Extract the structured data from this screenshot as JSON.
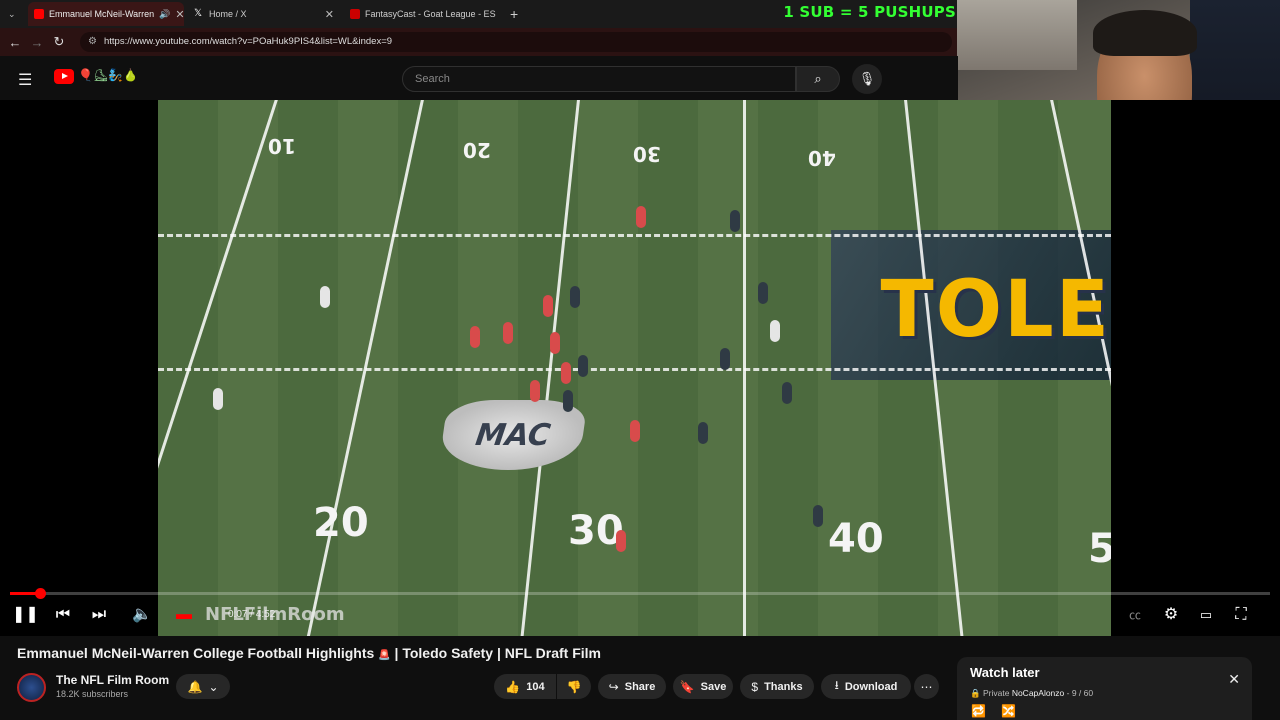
{
  "browser": {
    "tabs": [
      {
        "title": "Emmanuel McNeil-Warren",
        "favicon_color": "#ff0000",
        "active": true
      },
      {
        "title": "Home / X",
        "favicon_color": "#ffffff",
        "active": false
      },
      {
        "title": "FantasyCast - Goat League - ES",
        "favicon_color": "#cc0000",
        "active": false
      }
    ],
    "url": "https://www.youtube.com/watch?v=POaHuk9PIS4&list=WL&index=9"
  },
  "stream_overlay": {
    "text": "1 SUB = 5 PUSHUPS",
    "color": "#33ff33"
  },
  "youtube_header": {
    "search_placeholder": "Search",
    "doodle": "🎈⛸🧞🍐"
  },
  "video": {
    "field_numbers": {
      "top": [
        "10",
        "20",
        "30",
        "40"
      ],
      "bottom": [
        "20",
        "30",
        "40",
        "5"
      ]
    },
    "endzone_text": "TOLE",
    "logo_text": "MAC",
    "watermark": "NFLFilmRoom",
    "time": "0:07 / 4:52",
    "progress_fraction": 0.024
  },
  "metadata": {
    "title": "Emmanuel McNeil-Warren College Football Highlights",
    "title_suffix": "| Toledo Safety | NFL Draft Film",
    "channel": "The NFL Film Room",
    "subscribers": "18.2K subscribers",
    "likes": "104",
    "share_label": "Share",
    "save_label": "Save",
    "thanks_label": "Thanks",
    "download_label": "Download"
  },
  "watch_later": {
    "title": "Watch later",
    "privacy": "Private",
    "owner": "NoCapAlonzo",
    "position": "9 / 60"
  },
  "colors": {
    "accent": "#ff0000",
    "background": "#0f0f0f"
  }
}
